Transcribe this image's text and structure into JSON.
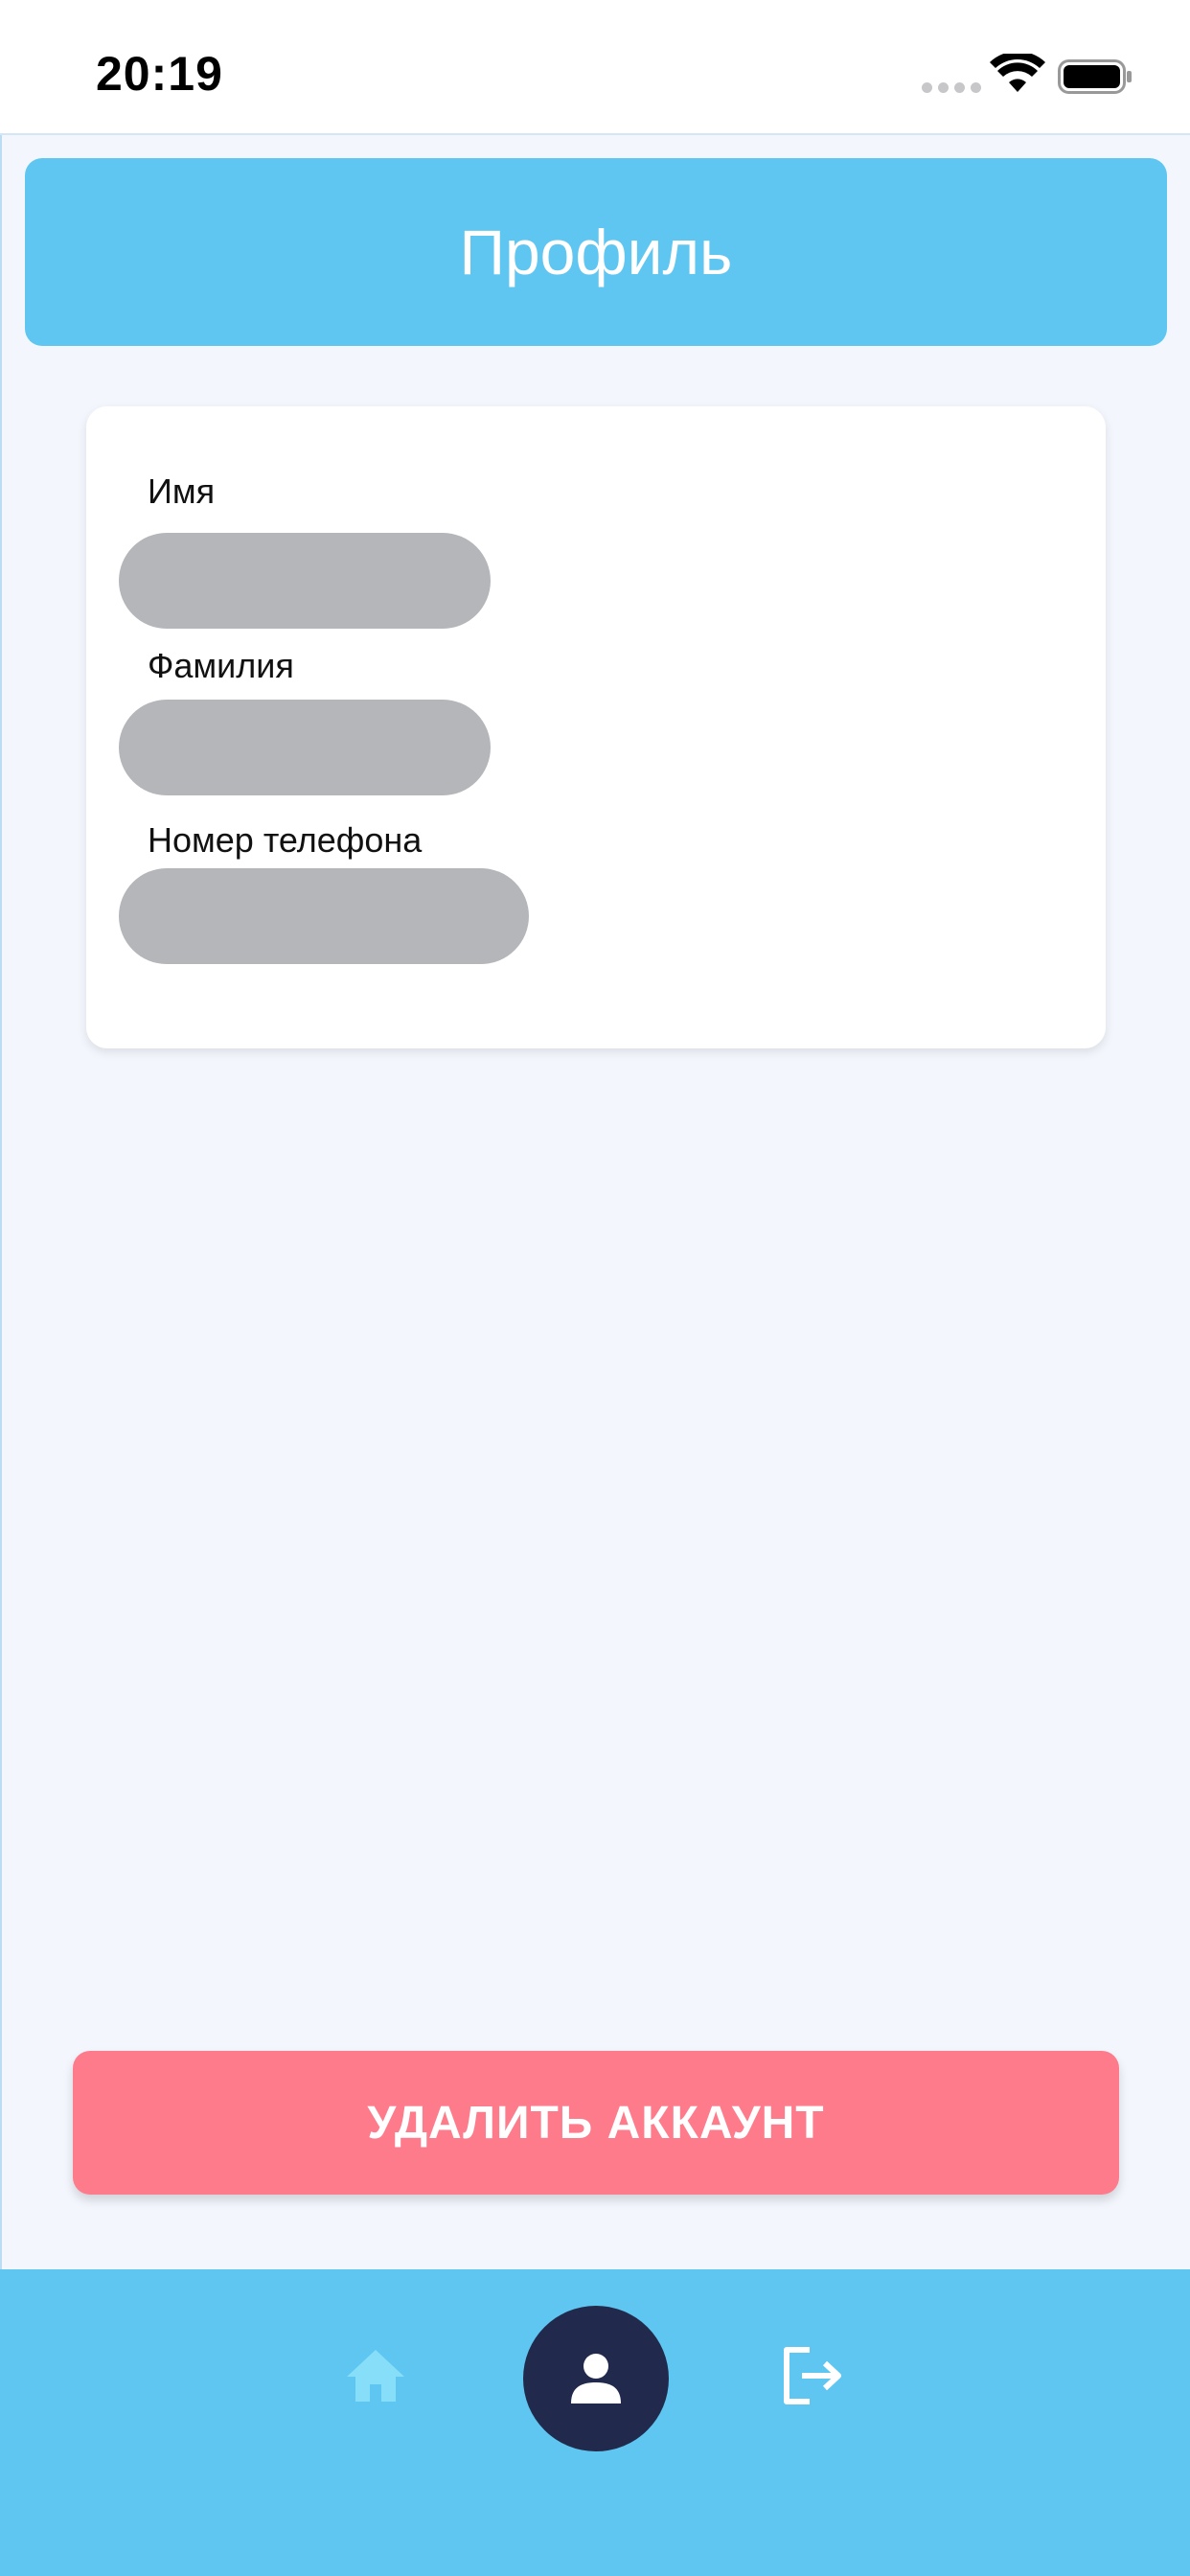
{
  "status_bar": {
    "time": "20:19"
  },
  "header": {
    "title": "Профиль"
  },
  "profile": {
    "fields": [
      {
        "label": "Имя"
      },
      {
        "label": "Фамилия"
      },
      {
        "label": "Номер телефона"
      }
    ]
  },
  "actions": {
    "delete_account_label": "УДАЛИТЬ АККАУНТ"
  },
  "bottom_nav": {
    "items": [
      {
        "icon": "home-icon",
        "active": false
      },
      {
        "icon": "user-icon",
        "active": true
      },
      {
        "icon": "logout-icon",
        "active": false
      }
    ]
  },
  "colors": {
    "accent": "#5ec6f0",
    "danger": "#fe7b8c",
    "nav_active": "#212a4c",
    "placeholder": "#b5b6ba",
    "background": "#f3f7fd"
  }
}
